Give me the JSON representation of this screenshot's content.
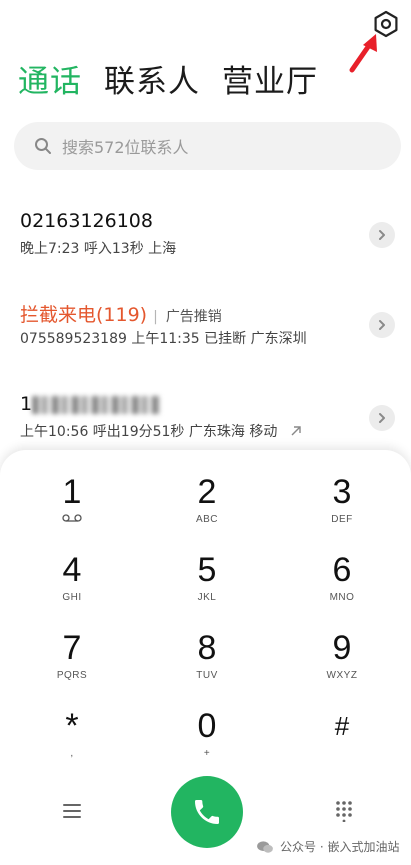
{
  "tabs": [
    {
      "label": "通话",
      "active": true
    },
    {
      "label": "联系人",
      "active": false
    },
    {
      "label": "营业厅",
      "active": false
    }
  ],
  "search": {
    "placeholder": "搜索572位联系人"
  },
  "calls": [
    {
      "title": "02163126108",
      "blocked": false,
      "tag": "",
      "detail": "晚上7:23   呼入13秒 上海"
    },
    {
      "title": "拦截来电(119)",
      "blocked": true,
      "tag": "广告推销",
      "detail": "075589523189 上午11:35  已挂断 广东深圳"
    },
    {
      "title": "1",
      "blocked": false,
      "tag": "",
      "detail": "上午10:56   呼出19分51秒 广东珠海 移动"
    }
  ],
  "keypad": [
    {
      "digit": "1",
      "letters": ""
    },
    {
      "digit": "2",
      "letters": "ABC"
    },
    {
      "digit": "3",
      "letters": "DEF"
    },
    {
      "digit": "4",
      "letters": "GHI"
    },
    {
      "digit": "5",
      "letters": "JKL"
    },
    {
      "digit": "6",
      "letters": "MNO"
    },
    {
      "digit": "7",
      "letters": "PQRS"
    },
    {
      "digit": "8",
      "letters": "TUV"
    },
    {
      "digit": "9",
      "letters": "WXYZ"
    },
    {
      "digit": "*",
      "letters": ","
    },
    {
      "digit": "0",
      "letters": "+"
    },
    {
      "digit": "#",
      "letters": ""
    }
  ],
  "watermark": "公众号 · 嵌入式加油站",
  "colors": {
    "accent": "#22b561",
    "blocked": "#e4572e",
    "arrow": "#e8202a"
  },
  "icons": [
    "settings-icon",
    "annotation-arrow",
    "search-icon",
    "chevron-right-icon",
    "voicemail-icon",
    "menu-icon",
    "phone-icon",
    "dialpad-grid-icon",
    "wechat-icon",
    "outgoing-call-icon"
  ]
}
